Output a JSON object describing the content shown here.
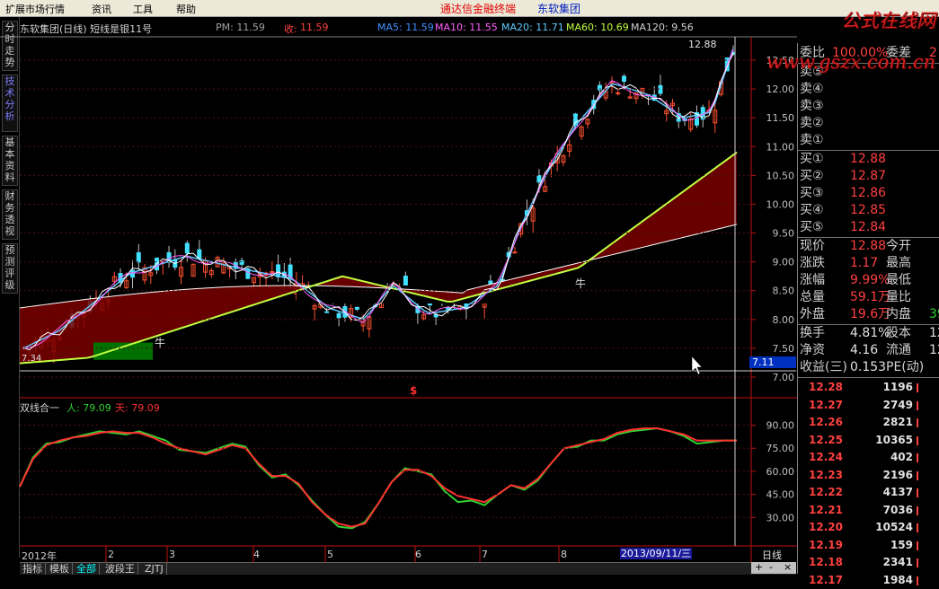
{
  "menu": {
    "items": [
      "扩展市场行情",
      "资讯",
      "工具",
      "帮助"
    ],
    "brand_main": "通达信金融终端",
    "brand_stock": "东软集团"
  },
  "logo_text": "公式在线网 www.gszx.com.cn",
  "sidebar_tabs": [
    {
      "label": "分时走势",
      "active": false
    },
    {
      "label": "技术分析",
      "active": true
    },
    {
      "label": "基本资料",
      "active": false
    },
    {
      "label": "财务透视",
      "active": false
    },
    {
      "label": "预测评级",
      "active": false
    }
  ],
  "main_header": {
    "title": "东软集团(日线) 短线是银11号",
    "pm": "PM: 11.59",
    "close_label": "收:",
    "close": "11.59",
    "ma5": "MA5: 11.59",
    "ma10": "MA10: 11.55",
    "ma20": "MA20: 11.71",
    "ma60": "MA60: 10.69",
    "ma120": "MA120: 9.56"
  },
  "colors": {
    "ma5": "#ffffff",
    "ma10": "#ff60ff",
    "ma20": "#60c8ff",
    "ma60": "#c0ff40",
    "ma120": "#ffffff",
    "up": "#ff5030",
    "down": "#40e0ff",
    "fill": "#7a0000",
    "fill_green": "#007000",
    "ren": "#ff3030",
    "tian": "#30d030",
    "axis": "#c01010"
  },
  "price_axis": {
    "min": 7.0,
    "max": 12.5,
    "ticks": [
      "12.50",
      "12.00",
      "11.50",
      "11.00",
      "10.50",
      "10.00",
      "9.50",
      "9.00",
      "8.50",
      "8.00",
      "7.50",
      "7.00"
    ]
  },
  "annotations": {
    "high_label": "12.88",
    "low_label": "7.34",
    "cow1": "牛",
    "cow2": "牛",
    "current_price_box": "7.11",
    "s_marker": "$"
  },
  "sub_header": {
    "title": "双线合一",
    "ren": "人: 79.09",
    "tian": "天: 79.09"
  },
  "sub_axis": {
    "min": 22,
    "max": 95,
    "ticks": [
      "90.00",
      "75.00",
      "60.00",
      "45.00",
      "30.00"
    ]
  },
  "chart_data": {
    "type": "line",
    "title": "双线合一",
    "xlabel": "",
    "ylabel": "",
    "ylim": [
      22,
      95
    ],
    "series": [
      {
        "name": "人",
        "values": [
          50,
          69,
          78,
          79,
          82,
          84,
          86,
          85,
          84,
          86,
          83,
          80,
          74,
          73,
          72,
          75,
          78,
          76,
          64,
          56,
          58,
          51,
          41,
          32,
          24,
          23,
          27,
          39,
          53,
          62,
          60,
          58,
          47,
          40,
          41,
          38,
          45,
          51,
          48,
          54,
          65,
          75,
          76,
          80,
          80,
          84,
          86,
          87,
          88,
          86,
          83,
          78,
          79,
          80,
          80
        ]
      },
      {
        "name": "天",
        "values": [
          50,
          68,
          77,
          80,
          82,
          83,
          85,
          86,
          85,
          85,
          82,
          78,
          75,
          73,
          71,
          74,
          77,
          75,
          65,
          57,
          57,
          52,
          40,
          32,
          26,
          24,
          26,
          39,
          53,
          61,
          61,
          57,
          49,
          44,
          42,
          40,
          45,
          51,
          49,
          55,
          65,
          75,
          77,
          79,
          81,
          85,
          87,
          88,
          88,
          86,
          84,
          80,
          80,
          80,
          80
        ]
      }
    ]
  },
  "time_axis": {
    "labels": [
      "2012年",
      "2",
      "3",
      "4",
      "5",
      "6",
      "7",
      "8"
    ],
    "cursor_date": "2013/09/11/三",
    "period": "日线"
  },
  "quote_panel": {
    "ratio_label": "委比",
    "ratio": "100.00%",
    "diff_label": "委差",
    "diff": "2",
    "sells": [
      {
        "label": "卖⑤",
        "price": ""
      },
      {
        "label": "卖④",
        "price": ""
      },
      {
        "label": "卖③",
        "price": ""
      },
      {
        "label": "卖②",
        "price": ""
      },
      {
        "label": "卖①",
        "price": ""
      }
    ],
    "buys": [
      {
        "label": "买①",
        "price": "12.88"
      },
      {
        "label": "买②",
        "price": "12.87"
      },
      {
        "label": "买③",
        "price": "12.86"
      },
      {
        "label": "买④",
        "price": "12.85"
      },
      {
        "label": "买⑤",
        "price": "12.84"
      }
    ],
    "stats": [
      {
        "l1": "现价",
        "v1": "12.88",
        "l2": "今开",
        "v2": ""
      },
      {
        "l1": "涨跌",
        "v1": "1.17",
        "l2": "最高",
        "v2": ""
      },
      {
        "l1": "涨幅",
        "v1": "9.99%",
        "l2": "最低",
        "v2": ""
      },
      {
        "l1": "总量",
        "v1": "59.1万",
        "l2": "量比",
        "v2": ""
      },
      {
        "l1": "外盘",
        "v1": "19.6万",
        "l2": "内盘",
        "v2": "39"
      }
    ],
    "stats2": [
      {
        "l1": "换手",
        "v1": "4.81%",
        "l2": "股本",
        "v2": "12"
      },
      {
        "l1": "净资",
        "v1": "4.16",
        "l2": "流通",
        "v2": "12"
      },
      {
        "l1": "收益(三)",
        "v1": "0.153",
        "l2": "PE(动)",
        "v2": ""
      }
    ],
    "ticks": [
      {
        "price": "12.28",
        "qty": "1196"
      },
      {
        "price": "12.27",
        "qty": "2749"
      },
      {
        "price": "12.26",
        "qty": "2821"
      },
      {
        "price": "12.25",
        "qty": "10365"
      },
      {
        "price": "12.24",
        "qty": "402"
      },
      {
        "price": "12.23",
        "qty": "2196"
      },
      {
        "price": "12.22",
        "qty": "4137"
      },
      {
        "price": "12.21",
        "qty": "7036"
      },
      {
        "price": "12.20",
        "qty": "10524"
      },
      {
        "price": "12.19",
        "qty": "159"
      },
      {
        "price": "12.18",
        "qty": "2341"
      },
      {
        "price": "12.17",
        "qty": "1984"
      }
    ]
  },
  "bottom_tabs": [
    {
      "label": "指标",
      "active": false
    },
    {
      "label": "模板",
      "active": false
    },
    {
      "label": "全部",
      "active": true
    },
    {
      "label": "波段王",
      "active": false
    },
    {
      "label": "ZJTJ",
      "active": false
    }
  ],
  "zoom_controls": [
    "+",
    "-",
    "×"
  ]
}
